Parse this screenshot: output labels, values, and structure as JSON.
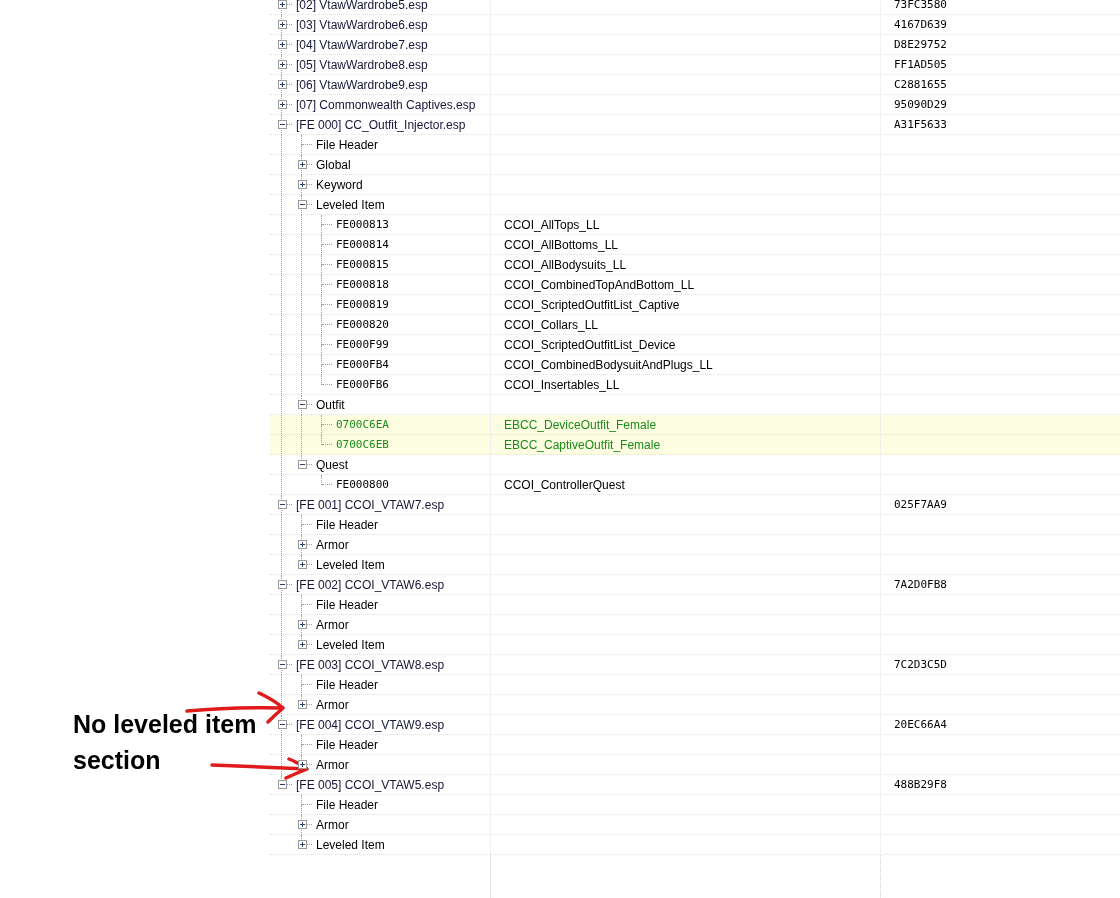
{
  "tree": [
    {
      "kind": "plugin",
      "label": "[02] VtawWardrobe5.esp",
      "crc": "73FC3580",
      "expanded": false
    },
    {
      "kind": "plugin",
      "label": "[03] VtawWardrobe6.esp",
      "crc": "4167D639",
      "expanded": false
    },
    {
      "kind": "plugin",
      "label": "[04] VtawWardrobe7.esp",
      "crc": "D8E29752",
      "expanded": false
    },
    {
      "kind": "plugin",
      "label": "[05] VtawWardrobe8.esp",
      "crc": "FF1AD505",
      "expanded": false
    },
    {
      "kind": "plugin",
      "label": "[06] VtawWardrobe9.esp",
      "crc": "C2881655",
      "expanded": false
    },
    {
      "kind": "plugin",
      "label": "[07] Commonwealth Captives.esp",
      "crc": "95090D29",
      "expanded": false
    },
    {
      "kind": "plugin",
      "label": "[FE 000] CC_Outfit_Injector.esp",
      "crc": "A31F5633",
      "expanded": true,
      "children": [
        {
          "kind": "leaf",
          "label": "File Header"
        },
        {
          "kind": "group",
          "label": "Global",
          "expanded": false
        },
        {
          "kind": "group",
          "label": "Keyword",
          "expanded": false
        },
        {
          "kind": "group",
          "label": "Leveled Item",
          "expanded": true,
          "children": [
            {
              "kind": "record",
              "label": "FE000813",
              "editor_id": "CCOI_AllTops_LL",
              "highlighted": false
            },
            {
              "kind": "record",
              "label": "FE000814",
              "editor_id": "CCOI_AllBottoms_LL",
              "highlighted": false
            },
            {
              "kind": "record",
              "label": "FE000815",
              "editor_id": "CCOI_AllBodysuits_LL",
              "highlighted": false
            },
            {
              "kind": "record",
              "label": "FE000818",
              "editor_id": "CCOI_CombinedTopAndBottom_LL",
              "highlighted": false
            },
            {
              "kind": "record",
              "label": "FE000819",
              "editor_id": "CCOI_ScriptedOutfitList_Captive",
              "highlighted": false
            },
            {
              "kind": "record",
              "label": "FE000820",
              "editor_id": "CCOI_Collars_LL",
              "highlighted": false
            },
            {
              "kind": "record",
              "label": "FE000F99",
              "editor_id": "CCOI_ScriptedOutfitList_Device",
              "highlighted": false
            },
            {
              "kind": "record",
              "label": "FE000FB4",
              "editor_id": "CCOI_CombinedBodysuitAndPlugs_LL",
              "highlighted": false
            },
            {
              "kind": "record",
              "label": "FE000FB6",
              "editor_id": "CCOI_Insertables_LL",
              "highlighted": false
            }
          ]
        },
        {
          "kind": "group",
          "label": "Outfit",
          "expanded": true,
          "children": [
            {
              "kind": "record",
              "label": "0700C6EA",
              "editor_id": "EBCC_DeviceOutfit_Female",
              "highlighted": true
            },
            {
              "kind": "record",
              "label": "0700C6EB",
              "editor_id": "EBCC_CaptiveOutfit_Female",
              "highlighted": true
            }
          ]
        },
        {
          "kind": "group",
          "label": "Quest",
          "expanded": true,
          "children": [
            {
              "kind": "record",
              "label": "FE000800",
              "editor_id": "CCOI_ControllerQuest",
              "highlighted": false
            }
          ]
        }
      ]
    },
    {
      "kind": "plugin",
      "label": "[FE 001] CCOI_VTAW7.esp",
      "crc": "025F7AA9",
      "expanded": true,
      "children": [
        {
          "kind": "leaf",
          "label": "File Header"
        },
        {
          "kind": "group",
          "label": "Armor",
          "expanded": false
        },
        {
          "kind": "group",
          "label": "Leveled Item",
          "expanded": false
        }
      ]
    },
    {
      "kind": "plugin",
      "label": "[FE 002] CCOI_VTAW6.esp",
      "crc": "7A2D0FB8",
      "expanded": true,
      "children": [
        {
          "kind": "leaf",
          "label": "File Header"
        },
        {
          "kind": "group",
          "label": "Armor",
          "expanded": false
        },
        {
          "kind": "group",
          "label": "Leveled Item",
          "expanded": false
        }
      ]
    },
    {
      "kind": "plugin",
      "label": "[FE 003] CCOI_VTAW8.esp",
      "crc": "7C2D3C5D",
      "expanded": true,
      "children": [
        {
          "kind": "leaf",
          "label": "File Header"
        },
        {
          "kind": "group",
          "label": "Armor",
          "expanded": false
        }
      ]
    },
    {
      "kind": "plugin",
      "label": "[FE 004] CCOI_VTAW9.esp",
      "crc": "20EC66A4",
      "expanded": true,
      "children": [
        {
          "kind": "leaf",
          "label": "File Header"
        },
        {
          "kind": "group",
          "label": "Armor",
          "expanded": false
        }
      ]
    },
    {
      "kind": "plugin",
      "label": "[FE 005] CCOI_VTAW5.esp",
      "crc": "488B29F8",
      "expanded": true,
      "children": [
        {
          "kind": "leaf",
          "label": "File Header"
        },
        {
          "kind": "group",
          "label": "Armor",
          "expanded": false
        },
        {
          "kind": "group",
          "label": "Leveled Item",
          "expanded": false
        }
      ]
    }
  ],
  "annotation": {
    "lines": [
      "No leveled item",
      "section"
    ]
  }
}
